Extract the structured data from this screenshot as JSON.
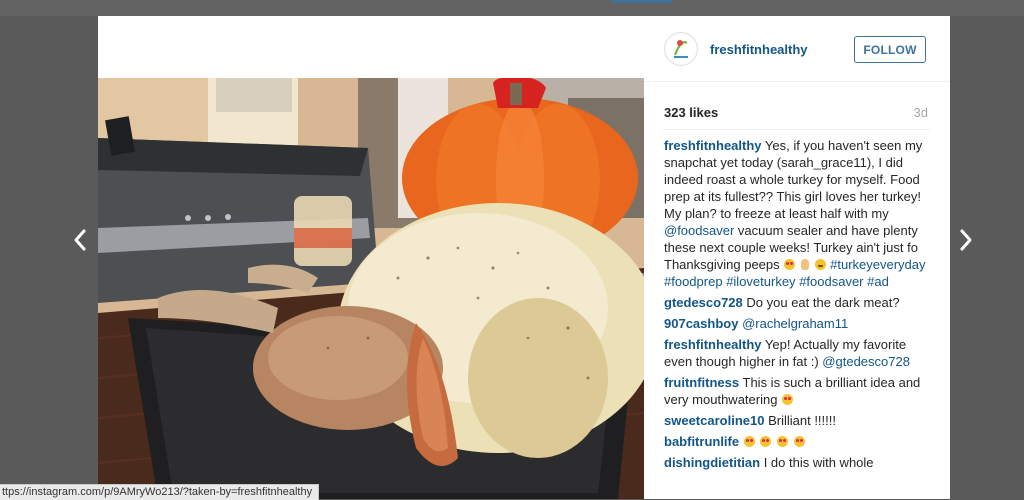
{
  "post": {
    "username": "freshfitnhealthy",
    "follow_label": "FOLLOW",
    "likes": "323 likes",
    "time_ago": "3d"
  },
  "caption": {
    "username": "freshfitnhealthy",
    "part1": "Yes, if you haven't seen my snapchat yet today (sarah_grace11), I did indeed roast a whole turkey for myself. Food prep at its fullest?? This girl loves her turkey! My plan? to freeze at least half with my",
    "mention": "@foodsaver",
    "part2": "vacuum sealer and have plenty these next couple weeks! Turkey ain't just fo Thanksgiving peeps",
    "hashtags": [
      "#turkeyeveryday",
      "#foodprep",
      "#iloveturkey",
      "#foodsaver",
      "#ad"
    ]
  },
  "comments": [
    {
      "user": "gtedesco728",
      "text": "Do you eat the dark meat?"
    },
    {
      "user": "907cashboy",
      "mention": "@rachelgraham11"
    },
    {
      "user": "freshfitnhealthy",
      "text": "Yep! Actually my favorite even though higher in fat :)",
      "mention": "@gtedesco728"
    },
    {
      "user": "fruitnfitness",
      "text": "This is such a brilliant idea and very mouthwatering"
    },
    {
      "user": "sweetcaroline10",
      "text": "Brilliant !!!!!!"
    },
    {
      "user": "babfitrunlife",
      "text": ""
    },
    {
      "user": "dishingdietitian",
      "text": "I do this with whole"
    }
  ],
  "status_bar": {
    "url": "ttps://instagram.com/p/9AMryWo213/?taken-by=freshfitnhealthy"
  },
  "icons": {
    "prev": "chevron-left-icon",
    "next": "chevron-right-icon",
    "avatar": "avatar-logo"
  },
  "colors": {
    "link": "#125688",
    "follow": "#3f729b",
    "backdrop": "#5a5a5a"
  }
}
